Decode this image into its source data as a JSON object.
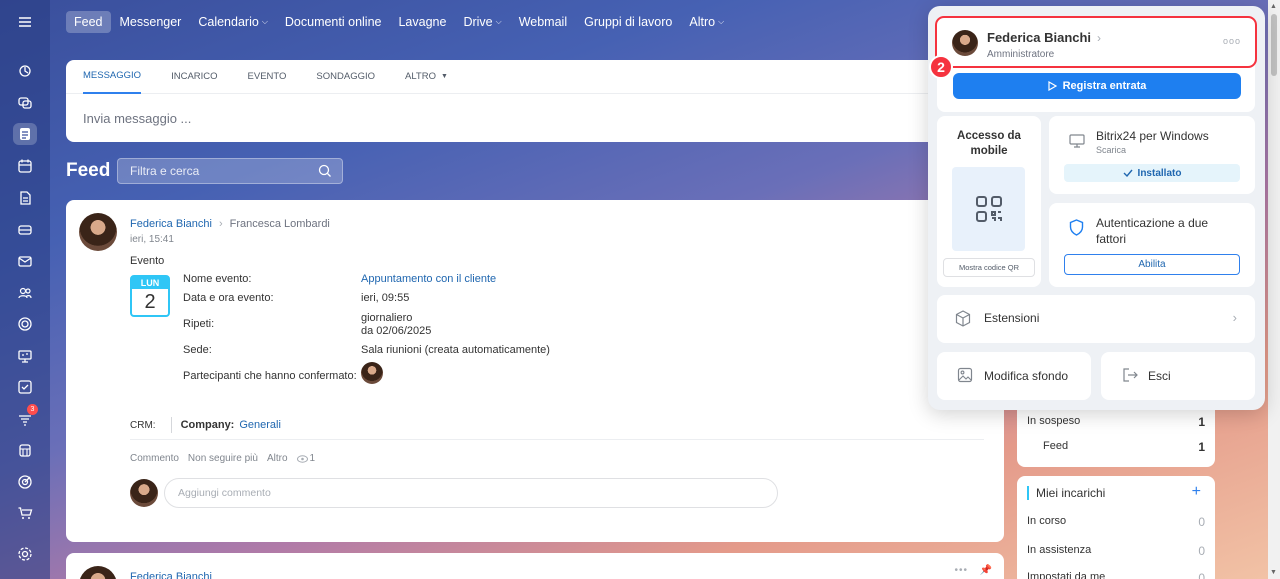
{
  "topnav": {
    "items": [
      {
        "label": "Feed",
        "active": true,
        "dropdown": false
      },
      {
        "label": "Messenger",
        "active": false,
        "dropdown": false
      },
      {
        "label": "Calendario",
        "active": false,
        "dropdown": true
      },
      {
        "label": "Documenti online",
        "active": false,
        "dropdown": false
      },
      {
        "label": "Lavagne",
        "active": false,
        "dropdown": false
      },
      {
        "label": "Drive",
        "active": false,
        "dropdown": true
      },
      {
        "label": "Webmail",
        "active": false,
        "dropdown": false
      },
      {
        "label": "Gruppi di lavoro",
        "active": false,
        "dropdown": false
      },
      {
        "label": "Altro",
        "active": false,
        "dropdown": true
      }
    ]
  },
  "sidebar": {
    "badge_count": "3",
    "icons": [
      "menu-icon",
      "activity-icon",
      "chat-icon",
      "feed-icon",
      "calendar-icon",
      "document-icon",
      "drive-icon",
      "mail-icon",
      "groups-icon",
      "crm-icon",
      "board-icon",
      "tasks-icon",
      "filter-icon",
      "store-icon",
      "target-icon",
      "cart-icon",
      "settings-icon"
    ]
  },
  "composer": {
    "tabs": [
      "MESSAGGIO",
      "INCARICO",
      "EVENTO",
      "SONDAGGIO",
      "ALTRO"
    ],
    "placeholder": "Invia messaggio ..."
  },
  "feed": {
    "title": "Feed",
    "search_placeholder": "Filtra e cerca"
  },
  "post": {
    "author": "Federica Bianchi",
    "recipient": "Francesca Lombardi",
    "time": "ieri, 15:41",
    "type": "Evento",
    "calendar_day": "LUN",
    "calendar_num": "2",
    "labels": {
      "name": "Nome evento:",
      "datetime": "Data e ora evento:",
      "repeat": "Ripeti:",
      "location": "Sede:",
      "participants": "Partecipanti che hanno confermato:"
    },
    "values": {
      "name": "Appuntamento con il cliente",
      "datetime": "ieri, 09:55",
      "repeat_1": "giornaliero",
      "repeat_2": "da 02/06/2025",
      "location": "Sala riunioni (creata automaticamente)"
    },
    "crm_label": "CRM:",
    "company_label": "Company:",
    "company_value": "Generali",
    "actions": {
      "comment": "Commento",
      "unfollow": "Non seguire più",
      "more": "Altro",
      "views": "1"
    },
    "comment_placeholder": "Aggiungi commento"
  },
  "post2": {
    "author": "Federica Bianchi"
  },
  "counters": {
    "rows": [
      {
        "label": "In sospeso",
        "value": "1"
      },
      {
        "label": "Feed",
        "value": "1"
      }
    ]
  },
  "tasks": {
    "title": "Miei incarichi",
    "rows": [
      {
        "label": "In corso",
        "value": "0"
      },
      {
        "label": "In assistenza",
        "value": "0"
      },
      {
        "label": "Impostati da me",
        "value": "0"
      }
    ]
  },
  "popup": {
    "user_name": "Federica Bianchi",
    "user_role": "Amministratore",
    "step_number": "2",
    "checkin_label": "Registra entrata",
    "mobile_title": "Accesso da mobile",
    "qr_button": "Mostra codice QR",
    "windows_title": "Bitrix24 per Windows",
    "windows_sub": "Scarica",
    "installed_label": "Installato",
    "twofa_title": "Autenticazione a due fattori",
    "enable_label": "Abilita",
    "extensions_label": "Estensioni",
    "background_label": "Modifica sfondo",
    "logout_label": "Esci"
  },
  "colors": {
    "accent": "#2f80ed",
    "highlight": "#f5333f",
    "link": "#2067b0"
  }
}
